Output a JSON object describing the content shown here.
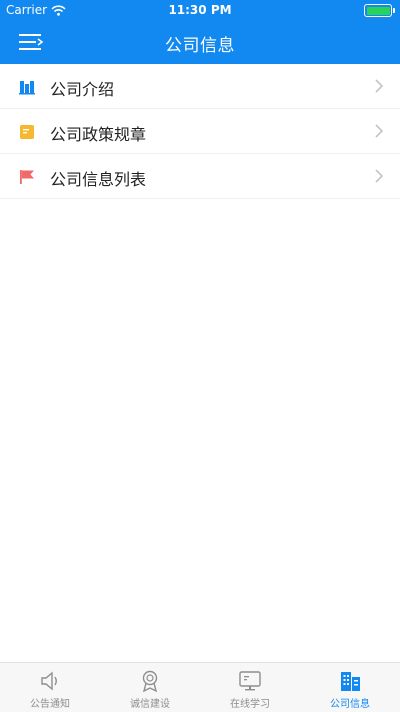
{
  "status_bar": {
    "carrier": "Carrier",
    "time": "11:30 PM",
    "battery_color": "#27d35a"
  },
  "navbar": {
    "title": "公司信息",
    "menu_icon": "menu-icon",
    "background": "#1289f0"
  },
  "list": {
    "items": [
      {
        "label": "公司介绍",
        "icon": "building-icon",
        "icon_color": "#1289f0"
      },
      {
        "label": "公司政策规章",
        "icon": "document-icon",
        "icon_color": "#f5b82e"
      },
      {
        "label": "公司信息列表",
        "icon": "flag-icon",
        "icon_color": "#f06a6a"
      }
    ]
  },
  "tabbar": {
    "items": [
      {
        "label": "公告通知",
        "icon": "speaker-icon",
        "active": false
      },
      {
        "label": "诚信建设",
        "icon": "badge-icon",
        "active": false
      },
      {
        "label": "在线学习",
        "icon": "monitor-icon",
        "active": false
      },
      {
        "label": "公司信息",
        "icon": "buildings-icon",
        "active": true
      }
    ],
    "active_color": "#1289f0",
    "inactive_color": "#8e8e8e"
  }
}
